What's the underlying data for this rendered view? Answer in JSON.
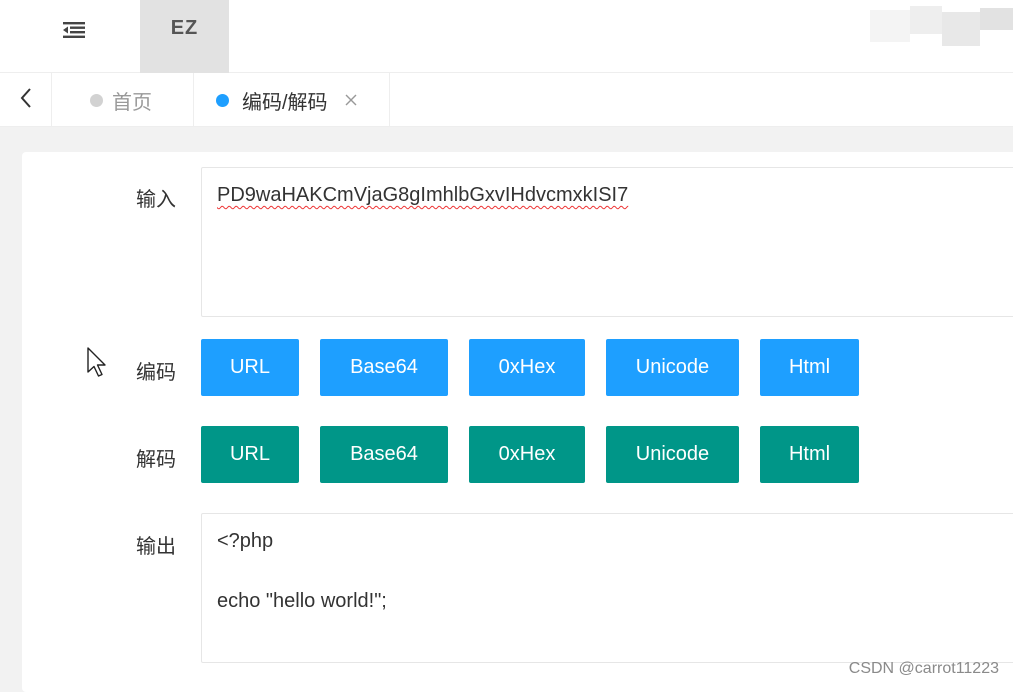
{
  "header": {
    "menu_icon": "outdent-icon",
    "brand": "EZ"
  },
  "tabs": {
    "prev_icon": "chevron-left-icon",
    "items": [
      {
        "label": "首页",
        "active": false
      },
      {
        "label": "编码/解码",
        "active": true,
        "closable": true
      }
    ],
    "close_icon": "close-icon"
  },
  "form": {
    "input": {
      "label": "输入",
      "value": "PD9waHAKCmVjaG8gImhlbGxvIHdvcmxkISI7"
    },
    "encode": {
      "label": "编码",
      "buttons": [
        "URL",
        "Base64",
        "0xHex",
        "Unicode",
        "Html"
      ]
    },
    "decode": {
      "label": "解码",
      "buttons": [
        "URL",
        "Base64",
        "0xHex",
        "Unicode",
        "Html"
      ]
    },
    "output": {
      "label": "输出",
      "lines": [
        "<?php",
        "",
        "echo \"hello world!\";"
      ]
    }
  },
  "watermark": "CSDN @carrot11223",
  "colors": {
    "primary_blue": "#1e9fff",
    "teal": "#009688",
    "brand_bg": "#e2e2e2"
  }
}
